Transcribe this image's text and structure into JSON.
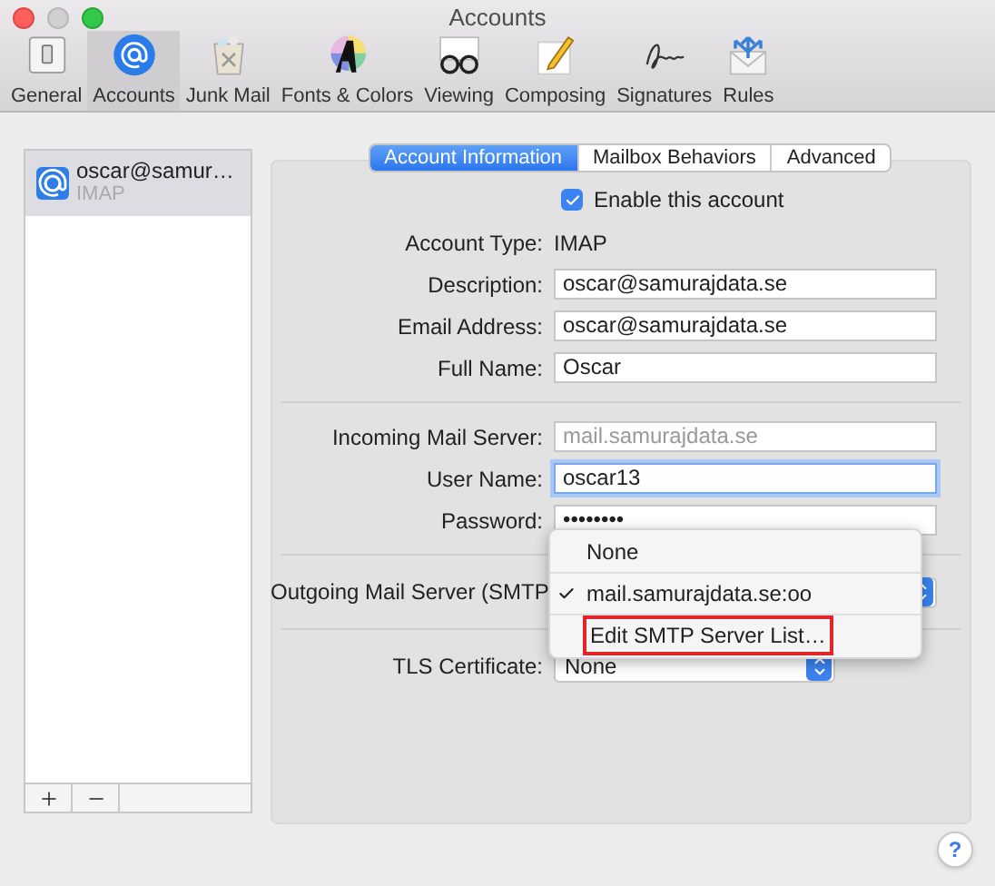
{
  "window": {
    "title": "Accounts"
  },
  "toolbar": [
    {
      "label": "General",
      "selected": false
    },
    {
      "label": "Accounts",
      "selected": true
    },
    {
      "label": "Junk Mail",
      "selected": false
    },
    {
      "label": "Fonts & Colors",
      "selected": false
    },
    {
      "label": "Viewing",
      "selected": false
    },
    {
      "label": "Composing",
      "selected": false
    },
    {
      "label": "Signatures",
      "selected": false
    },
    {
      "label": "Rules",
      "selected": false
    }
  ],
  "accounts": [
    {
      "name": "oscar@samur…",
      "type": "IMAP",
      "selected": true
    }
  ],
  "tabs": [
    {
      "label": "Account Information",
      "selected": true
    },
    {
      "label": "Mailbox Behaviors",
      "selected": false
    },
    {
      "label": "Advanced",
      "selected": false
    }
  ],
  "enable": {
    "label": "Enable this account",
    "checked": true
  },
  "rows": [
    {
      "kind": "text",
      "label": "Account Type:",
      "value": "IMAP"
    },
    {
      "kind": "field",
      "label": "Description:",
      "value": "oscar@samurajdata.se",
      "disabled": false,
      "focused": false
    },
    {
      "kind": "field",
      "label": "Email Address:",
      "value": "oscar@samurajdata.se",
      "disabled": false,
      "focused": false
    },
    {
      "kind": "field",
      "label": "Full Name:",
      "value": "Oscar",
      "disabled": false,
      "focused": false
    },
    {
      "kind": "divider"
    },
    {
      "kind": "field",
      "label": "Incoming Mail Server:",
      "value": "mail.samurajdata.se",
      "disabled": true,
      "focused": false
    },
    {
      "kind": "field",
      "label": "User Name:",
      "value": "oscar13",
      "disabled": false,
      "focused": true
    },
    {
      "kind": "field",
      "label": "Password:",
      "value": "••••••••",
      "disabled": false,
      "focused": false
    },
    {
      "kind": "divider"
    },
    {
      "kind": "popup",
      "label": "Outgoing Mail Server (SMTP",
      "open": true
    },
    {
      "kind": "divider"
    },
    {
      "kind": "popup",
      "label": "TLS Certificate:",
      "value": "None",
      "open": false
    }
  ],
  "smtp_menu": [
    {
      "label": "None",
      "selected": false,
      "highlighted": false
    },
    {
      "label": "mail.samurajdata.se:oo",
      "selected": true,
      "highlighted": false
    },
    {
      "label": "Edit SMTP Server List…",
      "selected": false,
      "highlighted": true
    }
  ],
  "help": "?"
}
